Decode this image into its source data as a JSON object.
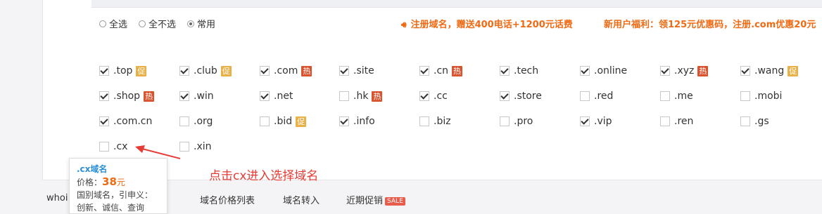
{
  "selection": {
    "options": [
      {
        "label": "全选",
        "checked": false
      },
      {
        "label": "全不选",
        "checked": false
      },
      {
        "label": "常用",
        "checked": true
      }
    ]
  },
  "promo": {
    "text1": "注册域名，赠送400电话+1200元话费",
    "text2": "新用户福利：领125元优惠码，注册.com优惠20元",
    "color": "#f06a13"
  },
  "domains": [
    {
      "name": ".top",
      "checked": true,
      "tag": "促",
      "tagType": "promo"
    },
    {
      "name": ".club",
      "checked": true,
      "tag": "促",
      "tagType": "promo"
    },
    {
      "name": ".com",
      "checked": true,
      "tag": "热",
      "tagType": "hot"
    },
    {
      "name": ".site",
      "checked": true,
      "tag": "",
      "tagType": ""
    },
    {
      "name": ".cn",
      "checked": true,
      "tag": "热",
      "tagType": "hot"
    },
    {
      "name": ".tech",
      "checked": true,
      "tag": "",
      "tagType": ""
    },
    {
      "name": ".online",
      "checked": true,
      "tag": "",
      "tagType": ""
    },
    {
      "name": ".xyz",
      "checked": true,
      "tag": "热",
      "tagType": "hot"
    },
    {
      "name": ".wang",
      "checked": true,
      "tag": "促",
      "tagType": "promo"
    },
    {
      "name": ".shop",
      "checked": true,
      "tag": "热",
      "tagType": "hot"
    },
    {
      "name": ".win",
      "checked": true,
      "tag": "",
      "tagType": ""
    },
    {
      "name": ".net",
      "checked": true,
      "tag": "",
      "tagType": ""
    },
    {
      "name": ".hk",
      "checked": false,
      "tag": "热",
      "tagType": "hot"
    },
    {
      "name": ".cc",
      "checked": true,
      "tag": "",
      "tagType": ""
    },
    {
      "name": ".store",
      "checked": true,
      "tag": "",
      "tagType": ""
    },
    {
      "name": ".red",
      "checked": false,
      "tag": "",
      "tagType": ""
    },
    {
      "name": ".me",
      "checked": false,
      "tag": "",
      "tagType": ""
    },
    {
      "name": ".mobi",
      "checked": false,
      "tag": "",
      "tagType": ""
    },
    {
      "name": ".com.cn",
      "checked": true,
      "tag": "",
      "tagType": ""
    },
    {
      "name": ".org",
      "checked": false,
      "tag": "",
      "tagType": ""
    },
    {
      "name": ".bid",
      "checked": false,
      "tag": "促",
      "tagType": "promo"
    },
    {
      "name": ".info",
      "checked": true,
      "tag": "",
      "tagType": ""
    },
    {
      "name": ".biz",
      "checked": false,
      "tag": "",
      "tagType": ""
    },
    {
      "name": ".pro",
      "checked": false,
      "tag": "",
      "tagType": ""
    },
    {
      "name": ".vip",
      "checked": true,
      "tag": "",
      "tagType": ""
    },
    {
      "name": ".ren",
      "checked": false,
      "tag": "",
      "tagType": ""
    },
    {
      "name": ".gs",
      "checked": false,
      "tag": "",
      "tagType": ""
    },
    {
      "name": ".cx",
      "checked": false,
      "tag": "",
      "tagType": ""
    },
    {
      "name": ".xin",
      "checked": false,
      "tag": "",
      "tagType": ""
    }
  ],
  "tooltip": {
    "name": ".cx域名",
    "price_label": "价格：",
    "price": "38",
    "unit": "元",
    "desc": "国别域名，引申义：创新、诚信、查询"
  },
  "annotation": {
    "text": "点击cx进入选择域名",
    "color": "#e63b34"
  },
  "bottom_nav": {
    "whois": "whoi",
    "items": [
      "域名价格列表",
      "域名转入",
      "近期促销"
    ],
    "sale_badge": "SALE"
  }
}
